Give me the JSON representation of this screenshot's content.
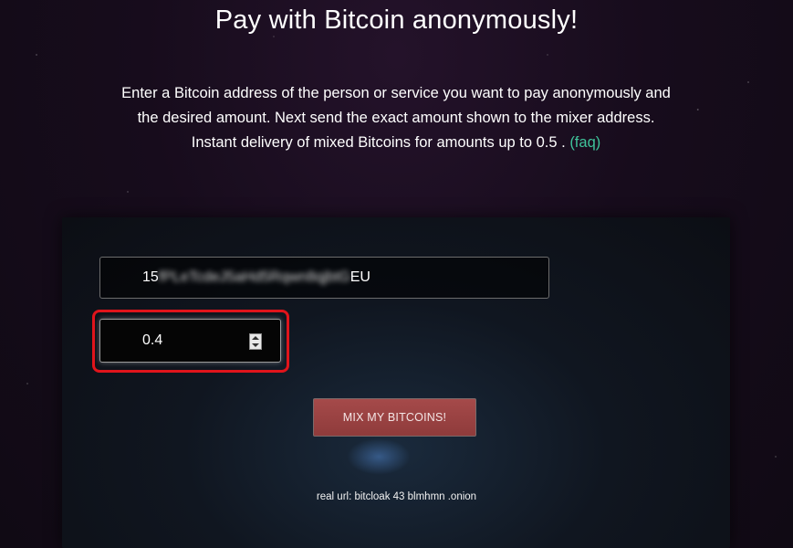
{
  "header": {
    "title": "Pay with Bitcoin anonymously!"
  },
  "intro": {
    "line1": "Enter a Bitcoin address of the person or service you want to pay anonymously and",
    "line2": "the desired amount. Next send the exact amount shown to the mixer address.",
    "line3": "Instant delivery of mixed Bitcoins for amounts up to 0.5 .",
    "faq_label": "(faq)"
  },
  "form": {
    "address_prefix": "15",
    "address_middle": "fPLeTcdeJ5aHd5Rqwn8qjbtG",
    "address_suffix": "EU",
    "amount_value": "0.4",
    "submit_label": "MIX MY BITCOINS!"
  },
  "footer": {
    "real_url": "real url: bitcloak 43 blmhmn .onion"
  },
  "colors": {
    "link": "#3fc39a",
    "button": "#9a4343",
    "highlight": "#e0141b"
  }
}
